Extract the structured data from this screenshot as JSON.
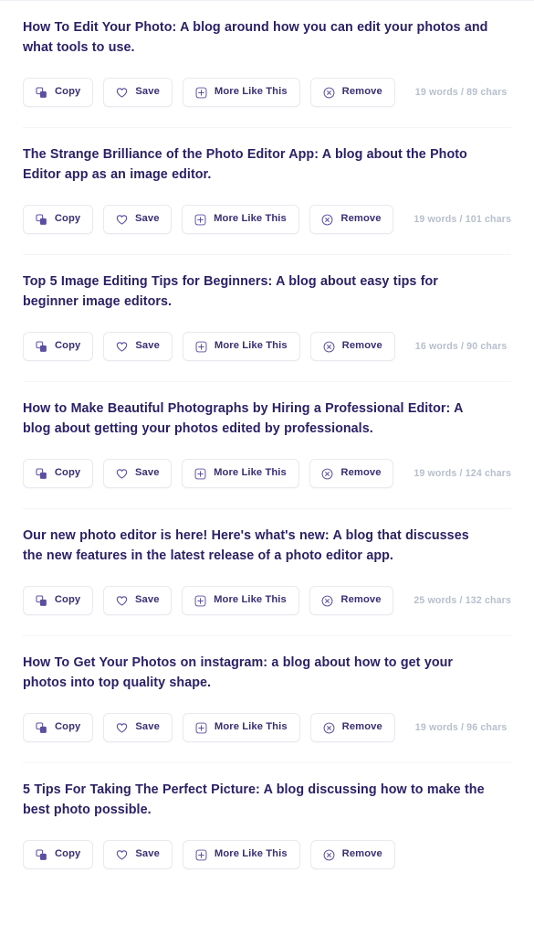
{
  "theme": {
    "background": "#ffffff",
    "title_color": "#2b2165",
    "button_label_color": "#3a2f73",
    "button_border_color": "#e8eaf0",
    "meta_color": "#b7bfcc",
    "divider_color": "#f2f5f8",
    "icon_color": "#5b4fa0"
  },
  "actions": {
    "copy": {
      "label": "Copy",
      "icon": "copy-icon"
    },
    "save": {
      "label": "Save",
      "icon": "heart-icon"
    },
    "more_like_this": {
      "label": "More Like This",
      "icon": "plus-square-icon"
    },
    "remove": {
      "label": "Remove",
      "icon": "close-circle-icon"
    }
  },
  "results": [
    {
      "title": "How To Edit Your Photo: A blog around how you can edit your photos and what tools to use.",
      "meta": "19 words / 89 chars",
      "words": 19,
      "chars": 89
    },
    {
      "title": "The Strange Brilliance of the Photo Editor App: A blog about the Photo Editor app as an image editor.",
      "meta": "19 words / 101 chars",
      "words": 19,
      "chars": 101
    },
    {
      "title": "Top 5 Image Editing Tips for Beginners: A blog about easy tips for beginner image editors.",
      "meta": "16 words / 90 chars",
      "words": 16,
      "chars": 90
    },
    {
      "title": "How to Make Beautiful Photographs by Hiring a Professional Editor: A blog about getting your photos edited by professionals.",
      "meta": "19 words / 124 chars",
      "words": 19,
      "chars": 124
    },
    {
      "title": "Our new photo editor is here! Here's what's new: A blog that discusses the new features in the latest release of a photo editor app.",
      "meta": "25 words / 132 chars",
      "words": 25,
      "chars": 132
    },
    {
      "title": "How To Get Your Photos on instagram: a blog about how to get your photos into top quality shape.",
      "meta": "19 words / 96 chars",
      "words": 19,
      "chars": 96
    },
    {
      "title": "5 Tips For Taking The Perfect Picture: A blog discussing how to make the best photo possible.",
      "meta": "",
      "words": null,
      "chars": null
    }
  ]
}
